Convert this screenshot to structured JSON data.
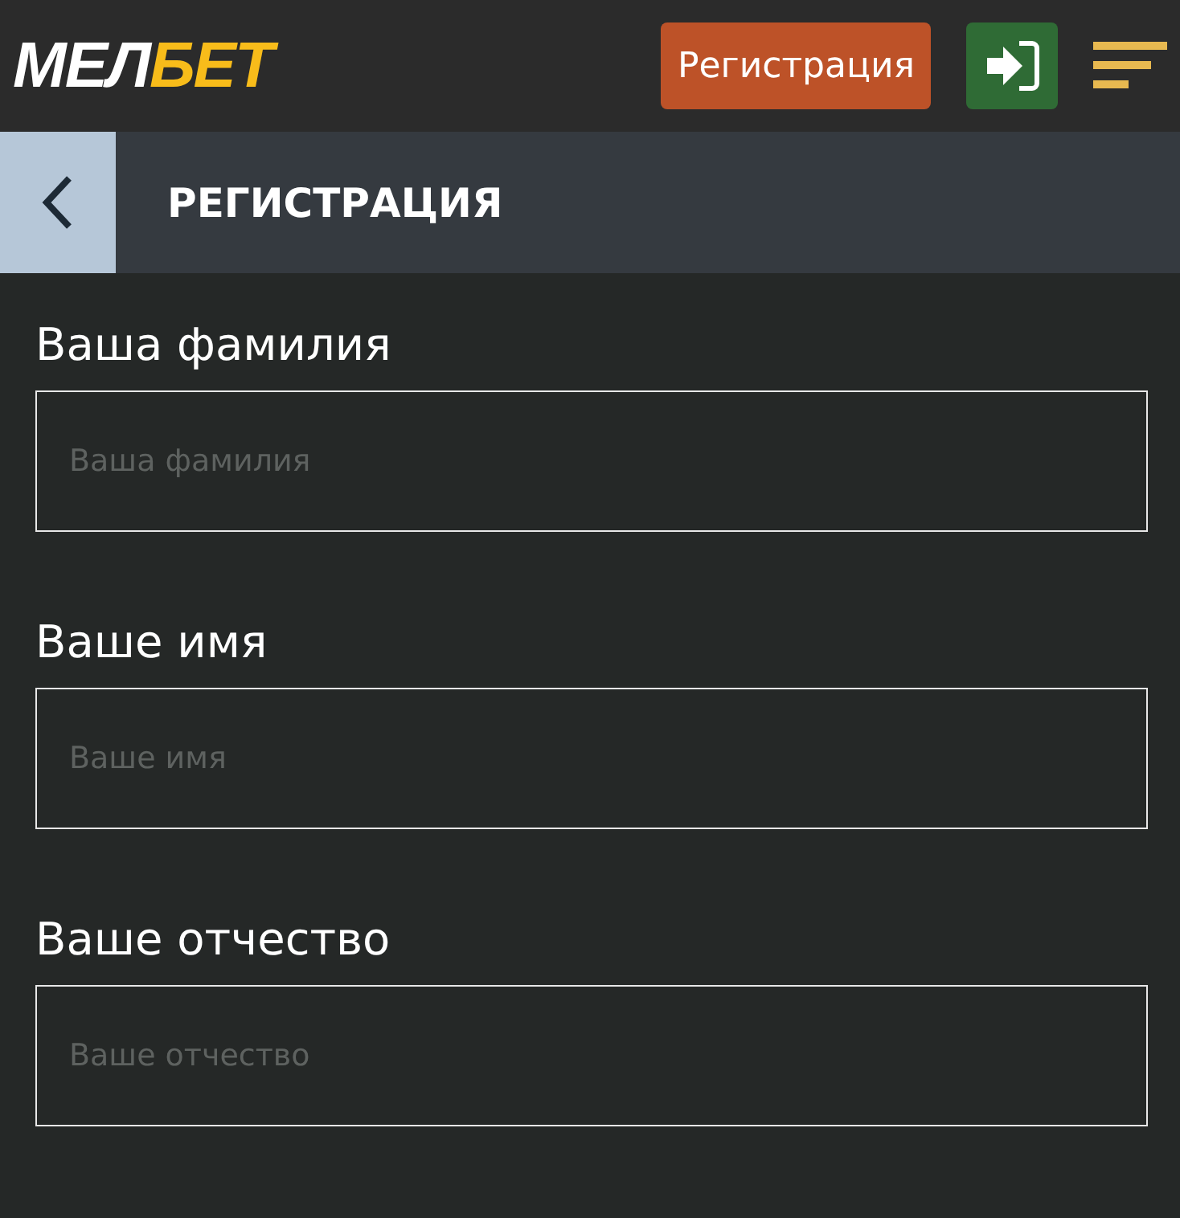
{
  "header": {
    "logo": [
      {
        "text": "МЕЛ",
        "color": "#ffffff"
      },
      {
        "text": "БЕТ",
        "color": "#f8bc1a"
      }
    ],
    "register_button": "Регистрация"
  },
  "title_bar": {
    "title": "РЕГИСТРАЦИЯ"
  },
  "fields": [
    {
      "label": "Ваша фамилия",
      "placeholder": "Ваша фамилия"
    },
    {
      "label": "Ваше имя",
      "placeholder": "Ваше имя"
    },
    {
      "label": "Ваше отчество",
      "placeholder": "Ваше отчество"
    }
  ]
}
